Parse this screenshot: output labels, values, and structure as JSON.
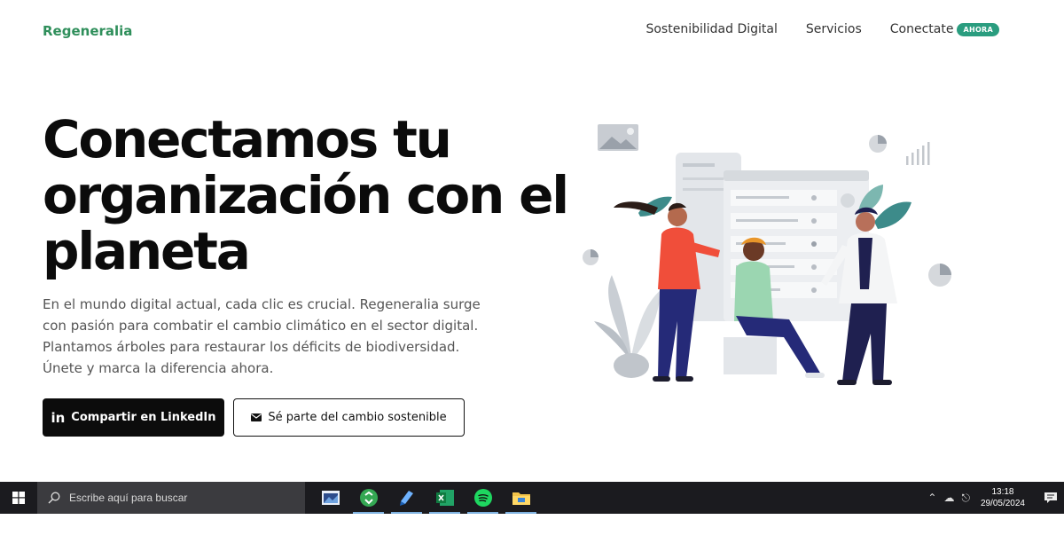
{
  "header": {
    "logo": "Regeneralia",
    "nav": {
      "item1": "Sostenibilidad Digital",
      "item2": "Servicios",
      "item3": "Conectate",
      "badge": "AHORA"
    }
  },
  "hero": {
    "title": "Conectamos tu organización con el planeta",
    "description": "En el mundo digital actual, cada clic es crucial. Regeneralia surge con pasión para combatir el cambio climático en el sector digital. Plantamos árboles para restaurar los déficits de biodiversidad. Únete y marca la diferencia ahora.",
    "primary_button": "Compartir en LinkedIn",
    "primary_icon": "in",
    "secondary_button": "Sé parte del cambio sostenible"
  },
  "colors": {
    "brand": "#2f8f5b",
    "badge": "#2a9d7f",
    "primary_button": "#0c0c0c",
    "taskbar": "#1b1b1f"
  },
  "taskbar": {
    "search_placeholder": "Escribe aquí para buscar",
    "apps": [
      "image-viewer-icon",
      "recycle-app-icon",
      "notes-app-icon",
      "excel-icon",
      "spotify-icon",
      "file-explorer-icon"
    ],
    "time": "13:18",
    "date": "29/05/2024"
  }
}
